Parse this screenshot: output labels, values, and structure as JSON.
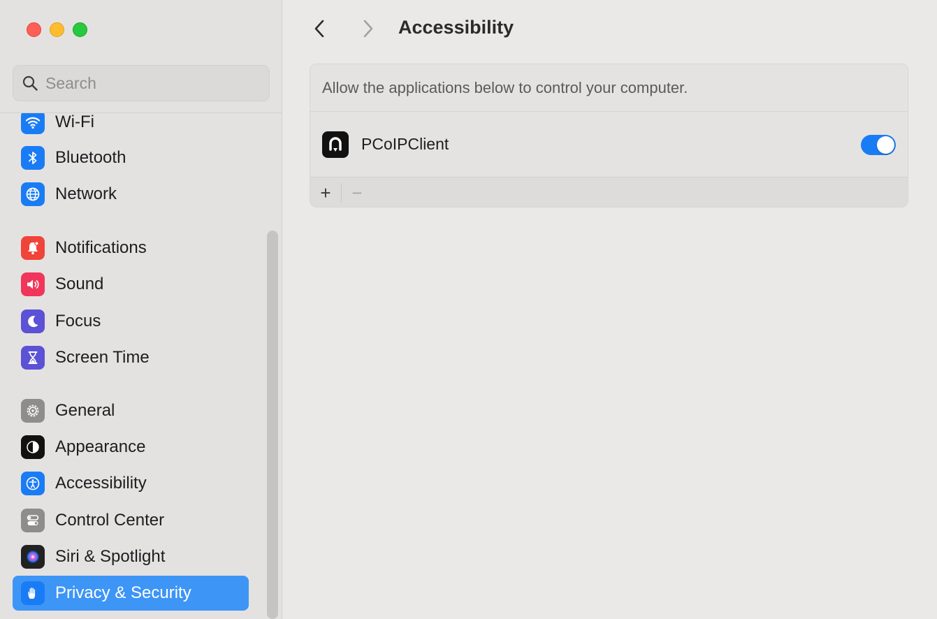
{
  "window": {
    "traffic_lights": [
      "close",
      "minimize",
      "maximize"
    ],
    "colors": {
      "close": "#fe5f57",
      "minimize": "#febc2e",
      "maximize": "#28c840",
      "accent": "#3d95f5",
      "toggle_on": "#1a7cf5"
    }
  },
  "sidebar": {
    "search": {
      "placeholder": "Search",
      "value": ""
    },
    "items": [
      {
        "label": "Wi-Fi",
        "icon": "wifi-icon",
        "color": "#1a7cf5"
      },
      {
        "label": "Bluetooth",
        "icon": "bluetooth-icon",
        "color": "#1a7cf5"
      },
      {
        "label": "Network",
        "icon": "globe-icon",
        "color": "#1a7cf5"
      },
      {
        "label": "Notifications",
        "icon": "bell-icon",
        "color": "#f0443a"
      },
      {
        "label": "Sound",
        "icon": "speaker-icon",
        "color": "#f0365a"
      },
      {
        "label": "Focus",
        "icon": "moon-icon",
        "color": "#5b52d6"
      },
      {
        "label": "Screen Time",
        "icon": "hourglass-icon",
        "color": "#5b52d6"
      },
      {
        "label": "General",
        "icon": "gear-icon",
        "color": "#8e8d8c"
      },
      {
        "label": "Appearance",
        "icon": "appearance-icon",
        "color": "#111111"
      },
      {
        "label": "Accessibility",
        "icon": "accessibility-icon",
        "color": "#1a7cf5"
      },
      {
        "label": "Control Center",
        "icon": "toggles-icon",
        "color": "#8e8d8c"
      },
      {
        "label": "Siri & Spotlight",
        "icon": "siri-icon",
        "color": "#222222"
      },
      {
        "label": "Privacy & Security",
        "icon": "hand-icon",
        "color": "#1a7cf5",
        "selected": true
      }
    ]
  },
  "header": {
    "title": "Accessibility",
    "back_icon": "chevron-left-icon",
    "forward_icon": "chevron-right-icon"
  },
  "main": {
    "description": "Allow the applications below to control your computer.",
    "apps": [
      {
        "name": "PCoIPClient",
        "icon": "pcoip-app-icon",
        "enabled": true
      }
    ],
    "footer": {
      "add_label": "+",
      "remove_label": "−"
    }
  }
}
